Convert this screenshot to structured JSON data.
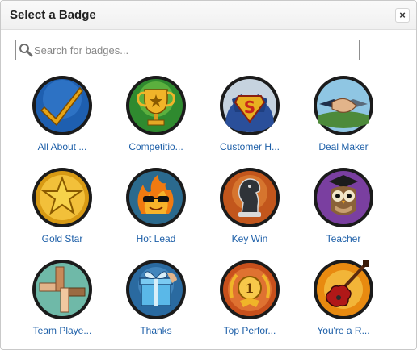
{
  "dialog": {
    "title": "Select a Badge",
    "close_label": "×"
  },
  "search": {
    "placeholder": "Search for badges...",
    "value": ""
  },
  "badges": [
    {
      "label": "All About ...",
      "icon": "checkmark-icon"
    },
    {
      "label": "Competitio...",
      "icon": "trophy-icon"
    },
    {
      "label": "Customer H...",
      "icon": "superhero-icon"
    },
    {
      "label": "Deal Maker",
      "icon": "handshake-icon"
    },
    {
      "label": "Gold Star",
      "icon": "star-icon"
    },
    {
      "label": "Hot Lead",
      "icon": "flaming-sunglasses-icon"
    },
    {
      "label": "Key Win",
      "icon": "chess-knight-icon"
    },
    {
      "label": "Teacher",
      "icon": "owl-icon"
    },
    {
      "label": "Team Playe...",
      "icon": "stacked-hands-icon"
    },
    {
      "label": "Thanks",
      "icon": "gift-box-icon"
    },
    {
      "label": "Top Perfor...",
      "icon": "first-place-medal-icon"
    },
    {
      "label": "You're a R...",
      "icon": "guitar-icon"
    }
  ],
  "colors": {
    "label_link": "#1d5fa8",
    "badge_ring": "#1b1b1b"
  }
}
